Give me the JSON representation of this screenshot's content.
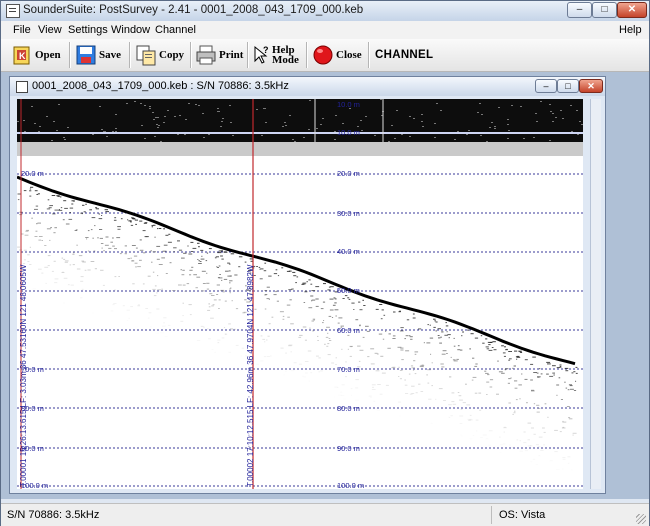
{
  "window": {
    "title": "SounderSuite: PostSurvey - 2.41 - 0001_2008_043_1709_000.keb",
    "controls": {
      "minimize": "–",
      "maximize": "□",
      "close": "✕"
    }
  },
  "menubar": {
    "items": [
      "File",
      "View",
      "Settings",
      "Window",
      "Channel"
    ],
    "help": "Help"
  },
  "toolbar": {
    "open": "Open",
    "save": "Save",
    "copy": "Copy",
    "print": "Print",
    "help_mode_line1": "Help",
    "help_mode_line2": "Mode",
    "close": "Close",
    "channel": "CHANNEL"
  },
  "child_window": {
    "title": "0001_2008_043_1709_000.keb : S/N 70886: 3.5kHz",
    "controls": {
      "minimize": "–",
      "maximize": "□",
      "close": "✕"
    }
  },
  "echogram": {
    "depth_labels_right": [
      "10.0 m",
      "20.0 m",
      "30.0 m",
      "40.0 m",
      "50.0 m",
      "60.0 m",
      "70.0 m",
      "80.0 m",
      "90.0 m",
      "100.0 m"
    ],
    "depth_labels_left": [
      "20.0 m",
      "70.0 m",
      "80.0 m",
      "90.0 m",
      "100.0 m"
    ],
    "left_annotation": "T.00001 15:26:13.615 LF: 3.03m 36 47.53160N 121 48.0605W",
    "marker_annotation": "T.00002 17:10:12.515 LF: 42.96m 36 47.9704N 121 47.8982W",
    "colors": {
      "grid": "#3a3a9a",
      "marker": "#c0282d",
      "label": "#22229a"
    }
  },
  "statusbar": {
    "left": "S/N 70886: 3.5kHz",
    "right": "OS: Vista"
  }
}
